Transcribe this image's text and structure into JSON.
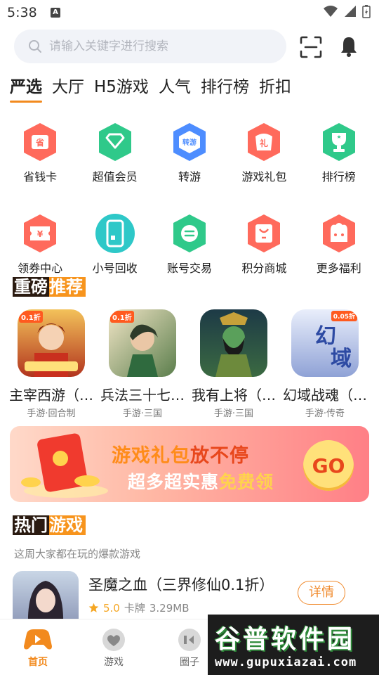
{
  "status_bar": {
    "time": "5:38",
    "indicator": "A"
  },
  "search": {
    "placeholder": "请输入关键字进行搜索"
  },
  "tabs": [
    {
      "label": "严选",
      "active": true
    },
    {
      "label": "大厅"
    },
    {
      "label": "H5游戏"
    },
    {
      "label": "人气"
    },
    {
      "label": "排行榜"
    },
    {
      "label": "折扣"
    }
  ],
  "grid": [
    {
      "label": "省钱卡",
      "icon": "savings-card-icon",
      "color": "#ff6a5c",
      "glyph": "省"
    },
    {
      "label": "超值会员",
      "icon": "vip-diamond-icon",
      "color": "#2fc98a",
      "glyph": ""
    },
    {
      "label": "转游",
      "icon": "transfer-game-icon",
      "color": "#4d8dff",
      "glyph": "转游"
    },
    {
      "label": "游戏礼包",
      "icon": "gift-pack-icon",
      "color": "#ff6a5c",
      "glyph": "礼"
    },
    {
      "label": "排行榜",
      "icon": "trophy-icon",
      "color": "#2fc98a",
      "glyph": ""
    },
    {
      "label": "领券中心",
      "icon": "coupon-icon",
      "color": "#ff6a5c",
      "glyph": "¥"
    },
    {
      "label": "小号回收",
      "icon": "phone-recycle-icon",
      "color": "#2ec8c8",
      "glyph": ""
    },
    {
      "label": "账号交易",
      "icon": "account-trade-icon",
      "color": "#2fc98a",
      "glyph": ""
    },
    {
      "label": "积分商城",
      "icon": "points-mall-icon",
      "color": "#ff6a5c",
      "glyph": ""
    },
    {
      "label": "更多福利",
      "icon": "more-benefits-icon",
      "color": "#ff6a5c",
      "glyph": ""
    }
  ],
  "recommend": {
    "title_a": "重磅",
    "title_b": "推荐",
    "games": [
      {
        "name": "主宰西游（…",
        "tag": "手游·回合制",
        "badge": "0.1折"
      },
      {
        "name": "兵法三十七…",
        "tag": "手游·三国",
        "badge": "0.1折"
      },
      {
        "name": "我有上将（…",
        "tag": "手游·三国",
        "badge": ""
      },
      {
        "name": "幻域战魂（…",
        "tag": "手游·传奇",
        "badge": "0.05折"
      }
    ]
  },
  "banner": {
    "line1_a": "游戏礼包",
    "line1_b": "放不停",
    "line2_a": "超多超实惠",
    "line2_b": "免费领",
    "go": "GO"
  },
  "hot": {
    "title_a": "热门",
    "title_b": "游戏",
    "subtitle": "这周大家都在玩的爆款游戏",
    "item": {
      "name": "圣魔之血（三界修仙0.1折）",
      "score": "5.0",
      "type": "卡牌",
      "size": "3.29MB",
      "button": "详情"
    }
  },
  "bottom_nav": [
    {
      "label": "首页",
      "active": true
    },
    {
      "label": "游戏"
    },
    {
      "label": "圈子"
    }
  ],
  "watermark": {
    "big": "谷普软件园",
    "small": "www.gupuxiazai.com"
  }
}
